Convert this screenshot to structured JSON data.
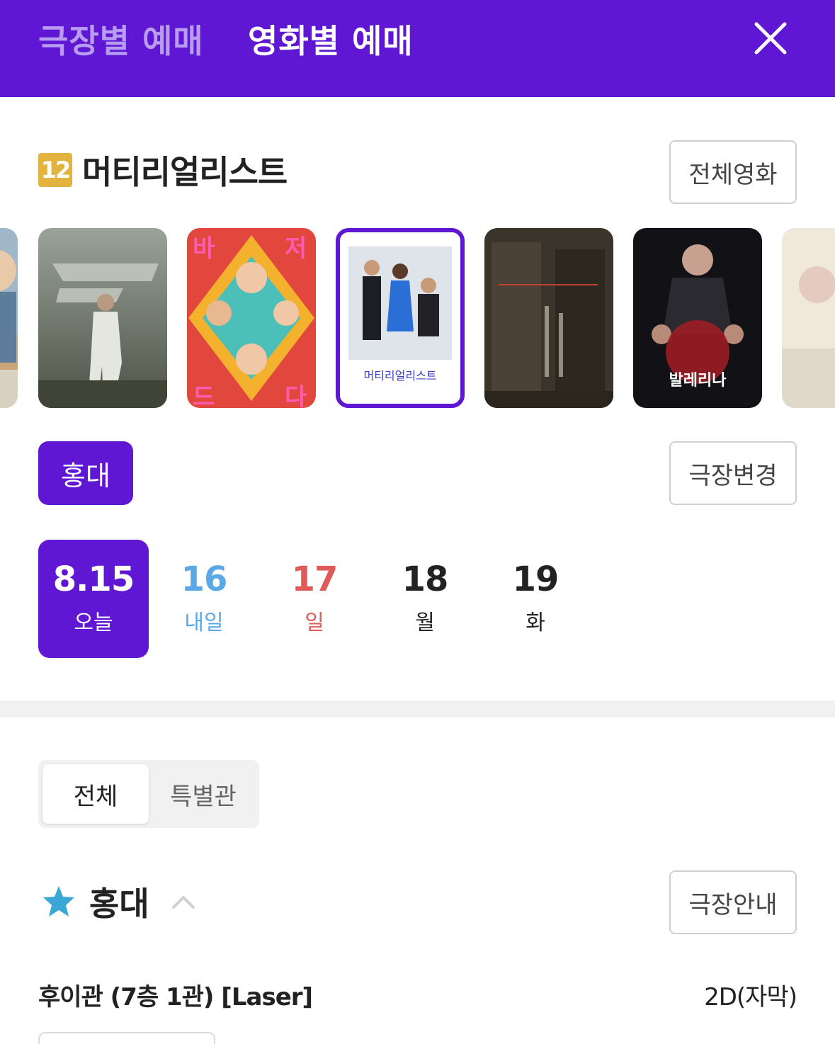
{
  "header": {
    "tabs": [
      {
        "label": "극장별 예매",
        "active": false
      },
      {
        "label": "영화별 예매",
        "active": true
      }
    ],
    "close_icon": "close-icon",
    "background_color": "#5f17d4"
  },
  "movie": {
    "age_rating": "12",
    "title": "머티리얼리스트",
    "all_movies_label": "전체영화"
  },
  "posters": [
    {
      "name": "poster-partial-left",
      "selected": false
    },
    {
      "name": "poster-f1",
      "selected": false
    },
    {
      "name": "poster-comedy",
      "selected": false
    },
    {
      "name": "poster-materialists",
      "selected": true
    },
    {
      "name": "poster-dark",
      "selected": false
    },
    {
      "name": "poster-ballerina",
      "selected": false,
      "title": "발레리나"
    },
    {
      "name": "poster-partial-right",
      "selected": false
    }
  ],
  "theater": {
    "selected": "홍대",
    "change_label": "극장변경"
  },
  "dates": [
    {
      "num": "8.15",
      "label": "오늘",
      "selected": true,
      "color": "#ffffff"
    },
    {
      "num": "16",
      "label": "내일",
      "selected": false,
      "color": "#5aa8e6"
    },
    {
      "num": "17",
      "label": "일",
      "selected": false,
      "color": "#e05a5a"
    },
    {
      "num": "18",
      "label": "월",
      "selected": false,
      "color": "#222222"
    },
    {
      "num": "19",
      "label": "화",
      "selected": false,
      "color": "#222222"
    }
  ],
  "filter": {
    "all": "전체",
    "special": "특별관"
  },
  "favorite_theater": {
    "name": "홍대",
    "star_icon": "star-icon",
    "star_color": "#3aa7d6",
    "info_label": "극장안내"
  },
  "hall": {
    "name": "후이관 (7층 1관) [Laser]",
    "format": "2D(자막)"
  }
}
